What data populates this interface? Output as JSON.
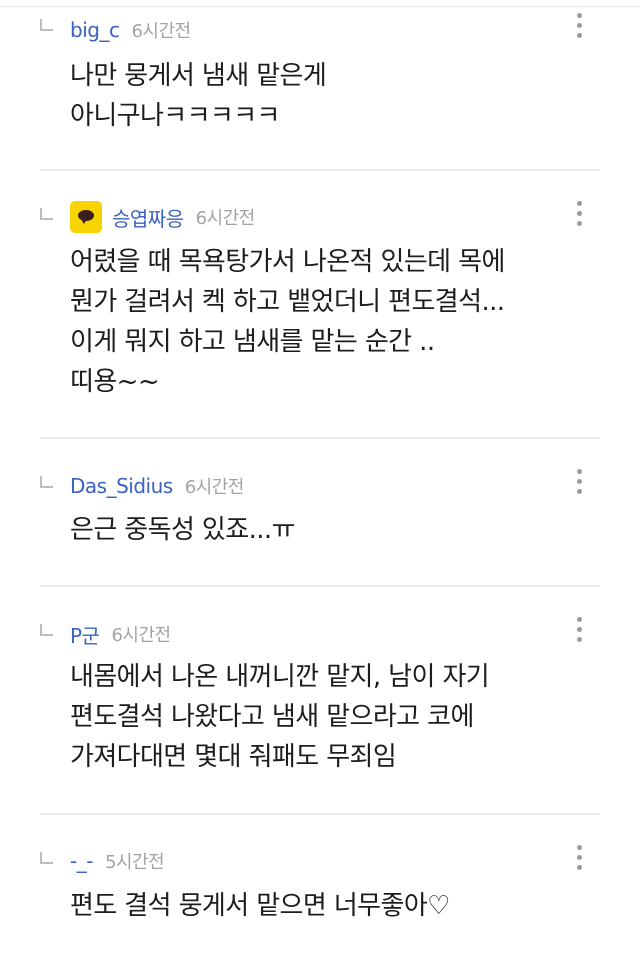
{
  "comments": [
    {
      "author": "big_c",
      "time": "6시간전",
      "text": "나만 뭉게서 냄새 맡은게\n아니구나ㅋㅋㅋㅋㅋ",
      "has_kakao_icon": false
    },
    {
      "author": "승엽짜응",
      "time": "6시간전",
      "text": "어렸을 때 목욕탕가서 나온적 있는데 목에\n뭔가 걸려서 켁 하고 뱉었더니 편도결석...\n이게 뭐지 하고 냄새를 맡는 순간 ..\n띠용~~",
      "has_kakao_icon": true
    },
    {
      "author": "Das_Sidius",
      "time": "6시간전",
      "text": "은근 중독성 있죠...ㅠ",
      "has_kakao_icon": false
    },
    {
      "author": "P군",
      "time": "6시간전",
      "text": "내몸에서 나온 내꺼니깐 맡지, 남이 자기\n편도결석 나왔다고 냄새 맡으라고 코에\n가져다대면 몇대 줘패도 무죄임",
      "has_kakao_icon": false
    },
    {
      "author": "-_-",
      "time": "5시간전",
      "text": "편도 결석 뭉게서 맡으면 너무좋아♡",
      "has_kakao_icon": false
    }
  ],
  "icons": {
    "reply": "reply-arrow-icon",
    "more": "more-vertical-icon",
    "badge": "kakao-talk-icon"
  },
  "colors": {
    "author": "#3a63c0",
    "time": "#a3a3a3",
    "text": "#1d1d1d",
    "divider": "#ececec",
    "kakao_badge": "#f7d400"
  }
}
